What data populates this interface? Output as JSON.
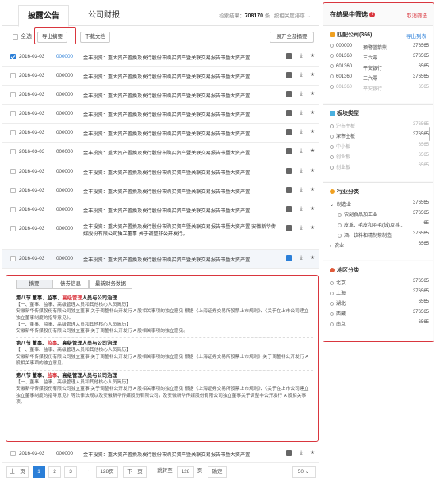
{
  "tabs": [
    "披露公告",
    "公司财报"
  ],
  "result": {
    "label": "检索结果：",
    "count": "708170",
    "unit": "条",
    "sort": "按相关度排序 ⌄"
  },
  "toolbar": {
    "select_all": "全选",
    "export": "导出摘要",
    "download": "下载文档",
    "expand": "展开全部摘要"
  },
  "rows": [
    {
      "date": "2016-03-03",
      "code": "000000",
      "title": "金丰投资：重大资产置换及发行股份市购买资产暨关联交易报告书暨大资产置",
      "checked": true,
      "code_blue": true
    },
    {
      "date": "2016-03-03",
      "code": "000000",
      "title": "金丰投资：重大资产置换及发行股份市购买资产暨关联交易报告书暨大资产置"
    },
    {
      "date": "2016-03-03",
      "code": "000000",
      "title": "金丰投资：重大资产置换及发行股份市购买资产暨关联交易报告书暨大资产置"
    },
    {
      "date": "2016-03-03",
      "code": "000000",
      "title": "金丰投资：重大资产置换及发行股份市购买资产暨关联交易报告书暨大资产置"
    },
    {
      "date": "2016-03-03",
      "code": "000000",
      "title": "金丰投资：重大资产置换及发行股份市购买资产暨关联交易报告书暨大资产置"
    },
    {
      "date": "2016-03-03",
      "code": "000000",
      "title": "金丰投资：重大资产置换及发行股份市购买资产暨关联交易报告书暨大资产置"
    },
    {
      "date": "2016-03-03",
      "code": "000000",
      "title": "金丰投资：重大资产置换及发行股份市购买资产暨关联交易报告书暨大资产置"
    },
    {
      "date": "2016-03-03",
      "code": "000000",
      "title": "金丰投资：重大资产置换及发行股份市购买资产暨关联交易报告书暨大资产置"
    },
    {
      "date": "2016-03-03",
      "code": "000000",
      "title": "金丰投资：重大资产置换及发行股份市购买资产暨关联交易报告书暨大资产置"
    },
    {
      "date": "2016-03-03",
      "code": "000000",
      "title": "金丰投资：重大资产置换及发行股份市购买资产暨关联交易报告书暨大资产置 安徽新华传媒股份有限公司独立董事 关于调整非公开发行。",
      "tall": true
    },
    {
      "date": "2016-03-03",
      "code": "000000",
      "title": "金丰投资：重大资产置换及发行股份市购买资产暨关联交易报告书暨大资产置",
      "selected": true
    }
  ],
  "detail": {
    "tabs": [
      "摘要",
      "债券信息",
      "最新财务数据"
    ],
    "blocks": [
      {
        "head_a": "第八节 董事、监事、",
        "head_red": "高级管理",
        "head_b": "人员与公司治理",
        "lines": [
          "【一、董事、监事、高级管理人员和其他核心人员简历】",
          "安徽新华传媒股份有限公司独立董事 关于调整非公开发行 A 股相关事项的独立意见 根据《上海证券交易所股票上市规则》、《关于在上市公司建立独立董事制度的指导意见》。",
          "【一、董事、监事、高级管理人员和其他核心人员简历】",
          "安徽新华传媒股份有限公司独立董事 关于调整非公开发行 A 股相关事项的独立意见。"
        ]
      },
      {
        "head_a": "第八节 董事、",
        "head_red": "监事",
        "head_b": "、高级管理人员与公司治理",
        "lines": [
          "【一、董事、监事、高级管理人员和其他核心人员简历】",
          "安徽新华传媒股份有限公司独立董事 关于调整非公开发行 A 股相关事项的独立意见 根据《上海证券交易所股票上市规则》关于调整非公开发行 A 股相关事项的独立意见。"
        ]
      },
      {
        "head_a": "第八节 董事、",
        "head_red": "监事",
        "head_b": "、高级管理人员与公司治理",
        "lines": [
          "【一、董事、监事、高级管理人员和其他核心人员简历】",
          "安徽新华传媒股份有限公司独立董事 关于调整非公开发行 A 股相关事项的独立意见 根据《上海证券交易所股票上市规则》、《关于在上市公司建立独立董事制度的指导意见》等法律法规以及安徽新华传媒股份有限公司，及安徽新华传媒股份有限公司独立董事关于调整非公开发行 A 股相关事项。"
        ]
      }
    ]
  },
  "last_row": {
    "date": "2016-03-03",
    "code": "000000",
    "title": "金丰投资：重大资产置换及发行股份市购买资产暨关联交易报告书暨大资产置"
  },
  "pager": {
    "prev": "上一页",
    "pages": [
      "1",
      "2",
      "3",
      "···",
      "128页"
    ],
    "next": "下一页",
    "jump_label": "跳转至",
    "jump_value": "128",
    "jump_unit": "页",
    "confirm": "确定",
    "per_page": "50 ⌄"
  },
  "filter": {
    "title": "在结果中筛选",
    "cancel": "取消筛选",
    "company": {
      "title": "匹配公司(366)",
      "link": "导出列表",
      "items": [
        {
          "code": "000000",
          "name": "预警蓝箭熊",
          "count": "376565"
        },
        {
          "code": "601360",
          "name": "三六零",
          "count": "376565"
        },
        {
          "code": "601360",
          "name": "平安银行",
          "count": "6565"
        },
        {
          "code": "601360",
          "name": "三六零",
          "count": "376565"
        },
        {
          "code": "601360",
          "name": "平安银行",
          "count": "6565",
          "dim": true
        }
      ]
    },
    "board": {
      "title": "板块类型",
      "items": [
        {
          "name": "沪市主板",
          "count": "376565",
          "dim": true
        },
        {
          "name": "深市主板",
          "count": "376565"
        },
        {
          "name": "中小板",
          "count": "6565",
          "dim": true
        },
        {
          "name": "创业板",
          "count": "6565",
          "dim": true
        },
        {
          "name": "创业板",
          "count": "6565",
          "dim": true
        }
      ]
    },
    "industry": {
      "title": "行业分类",
      "items": [
        {
          "name": "制造业",
          "count": "376565",
          "arrow": "⌄"
        },
        {
          "name": "农副食品加工业",
          "count": "376565",
          "sub": true
        },
        {
          "name": "皮革、毛皮和羽毛(绒)及其...",
          "count": "65",
          "sub": true
        },
        {
          "name": "酒、饮料和精制茶制造",
          "count": "376565",
          "sub": true
        },
        {
          "name": "农业",
          "count": "6565",
          "arrow": "›"
        }
      ]
    },
    "region": {
      "title": "地区分类",
      "items": [
        {
          "name": "北京",
          "count": "376565"
        },
        {
          "name": "上海",
          "count": "376565"
        },
        {
          "name": "湖北",
          "count": "6565"
        },
        {
          "name": "西藏",
          "count": "376565"
        },
        {
          "name": "南京",
          "count": "6565"
        }
      ]
    }
  }
}
